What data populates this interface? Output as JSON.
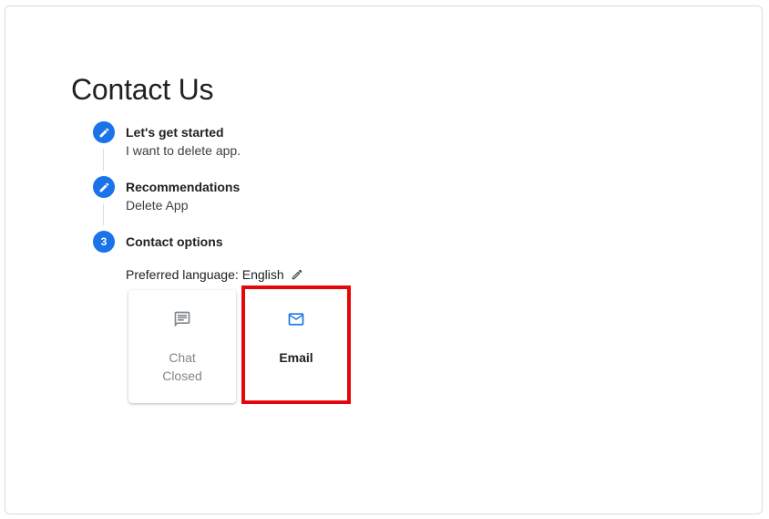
{
  "page": {
    "title": "Contact Us"
  },
  "steps": [
    {
      "number": "",
      "title": "Let's get started",
      "subtitle": "I want to delete app.",
      "icon": "pencil-icon"
    },
    {
      "number": "",
      "title": "Recommendations",
      "subtitle": "Delete App",
      "icon": "pencil-icon"
    },
    {
      "number": "3",
      "title": "Contact options",
      "subtitle": ""
    }
  ],
  "preferred_language": {
    "label": "Preferred language:",
    "value": "English",
    "icon": "pencil-icon"
  },
  "contact_options": [
    {
      "label_line1": "Chat",
      "label_line2": "Closed",
      "icon": "chat-icon",
      "enabled": false
    },
    {
      "label_line1": "Email",
      "label_line2": "",
      "icon": "mail-icon",
      "enabled": true
    }
  ],
  "colors": {
    "accent": "#1a73e8",
    "highlight": "#e5060b",
    "disabled_text": "#80868b"
  }
}
